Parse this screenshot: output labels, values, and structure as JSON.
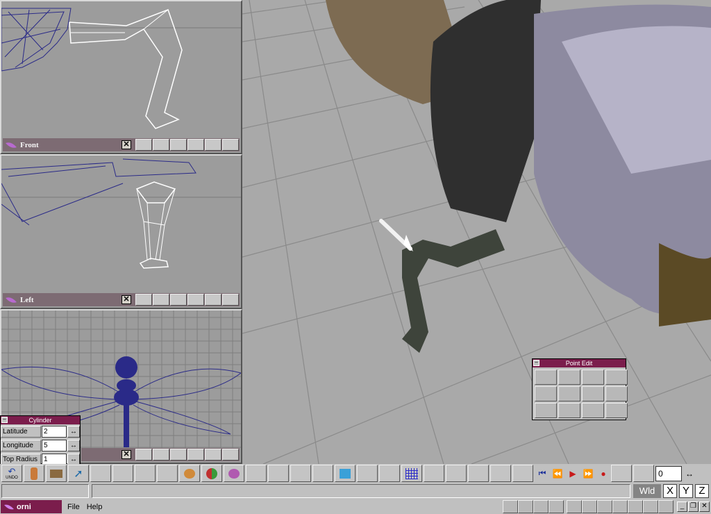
{
  "viewports": {
    "front": {
      "title": "Front"
    },
    "left": {
      "title": "Left"
    },
    "top": {
      "title": ""
    }
  },
  "cylinder_panel": {
    "title": "Cylinder",
    "fields": [
      {
        "label": "Latitude",
        "value": "2"
      },
      {
        "label": "Longitude",
        "value": "5"
      },
      {
        "label": "Top Radius",
        "value": "1"
      }
    ]
  },
  "point_edit_panel": {
    "title": "Point Edit"
  },
  "toolbar": {
    "undo_label": "UNDO",
    "frame_value": "0"
  },
  "status": {
    "coord_space": "Wld",
    "axes": [
      "X",
      "Y",
      "Z"
    ]
  },
  "menubar": {
    "app_name": "orni",
    "menus": [
      "File",
      "Help"
    ]
  },
  "colors": {
    "accent": "#7b1d4c",
    "viewport_bar": "#7d6b73",
    "grid_bg": "#a9a9a9",
    "wire_blue": "#2a2a88"
  }
}
